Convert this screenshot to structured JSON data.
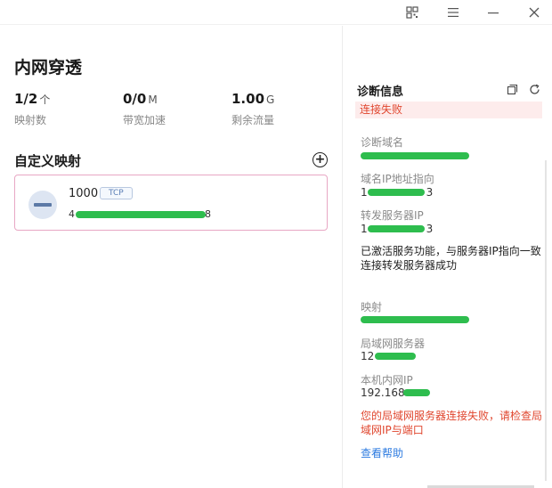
{
  "window": {
    "icons": [
      "qr-code-icon",
      "menu-icon",
      "minimize-icon",
      "close-icon"
    ]
  },
  "left": {
    "title": "内网穿透",
    "stats": [
      {
        "value": "1/2",
        "unit": "个",
        "label": "映射数"
      },
      {
        "value": "0/0",
        "unit": "M",
        "label": "带宽加速"
      },
      {
        "value": "1.00",
        "unit": "G",
        "label": "剩余流量"
      }
    ],
    "section_title": "自定义映射",
    "mapping": {
      "port": "1000",
      "protocol": "TCP",
      "addr_prefix": "4",
      "addr_suffix": "8"
    }
  },
  "right": {
    "title": "诊断信息",
    "status": "连接失败",
    "domain_label": "诊断域名",
    "ip_label": "域名IP地址指向",
    "ip_prefix": "1",
    "ip_suffix": "3",
    "fwd_label": "转发服务器IP",
    "fwd_prefix": "1",
    "fwd_suffix": "3",
    "active_msg": "已激活服务功能，与服务器IP指向一致连接转发服务器成功",
    "mapping_label": "映射",
    "lan_label": "局域网服务器",
    "lan_prefix": "12",
    "local_label": "本机内网IP",
    "local_prefix": "192.168",
    "fail_msg": "您的局域网服务器连接失败，请检查局域网IP与端口",
    "help": "查看帮助"
  },
  "colors": {
    "error": "#e0462e",
    "link": "#2d7be0",
    "redaction": "#2ebd4e",
    "card_border": "#e8a7c4"
  }
}
